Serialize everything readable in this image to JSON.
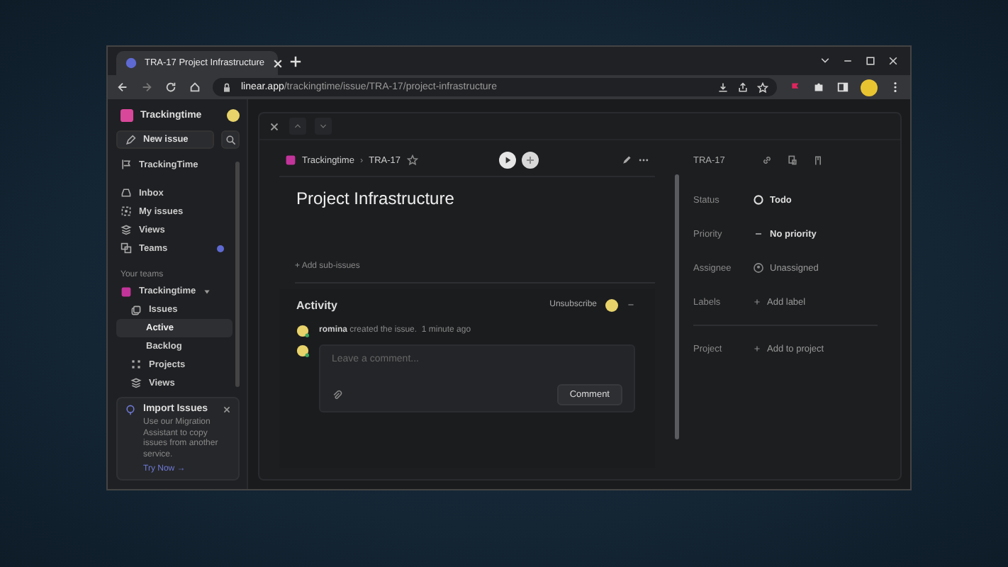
{
  "browser": {
    "tab_title": "TRA-17 Project Infrastructure",
    "url_host": "linear.app",
    "url_path": "/trackingtime/issue/TRA-17/project-infrastructure"
  },
  "sidebar": {
    "workspace": "Trackingtime",
    "new_issue": "New issue",
    "team_link": "TrackingTime",
    "nav": [
      {
        "label": "Inbox",
        "kind": "inbox",
        "badge": false
      },
      {
        "label": "My issues",
        "kind": "target",
        "badge": false
      },
      {
        "label": "Views",
        "kind": "layers",
        "badge": false
      },
      {
        "label": "Teams",
        "kind": "teams",
        "badge": true
      }
    ],
    "section": "Your teams",
    "team": {
      "label": "Trackingtime",
      "expanded": true,
      "children": [
        {
          "label": "Issues",
          "kind": "issues",
          "selected": false,
          "children": [
            {
              "label": "Active",
              "selected": true
            },
            {
              "label": "Backlog",
              "selected": false
            }
          ]
        },
        {
          "label": "Projects",
          "kind": "grid",
          "selected": false
        },
        {
          "label": "Views",
          "kind": "layers",
          "selected": false
        }
      ]
    },
    "import_card": {
      "title": "Import Issues",
      "body": "Use our Migration Assistant to copy issues from another service.",
      "link": "Try Now →"
    }
  },
  "issue": {
    "breadcrumb": [
      "Trackingtime",
      "›",
      "TRA-17"
    ],
    "title": "Project Infrastructure",
    "add_sub_issues": "+ Add sub-issues",
    "activity": {
      "heading": "Activity",
      "unsubscribe": "Unsubscribe",
      "events": [
        {
          "user": "romina",
          "text": "created the issue.",
          "time": "1 minute ago"
        }
      ],
      "comment": {
        "placeholder": "Leave a comment...",
        "button": "Comment"
      }
    }
  },
  "properties": {
    "id": "TRA-17",
    "rows": [
      {
        "label": "Status",
        "kind": "status",
        "value": "Todo"
      },
      {
        "label": "Priority",
        "kind": "priority",
        "value": "No priority"
      },
      {
        "label": "Assignee",
        "kind": "assignee",
        "value": "Unassigned"
      },
      {
        "label": "Labels",
        "kind": "add",
        "value": "Add label"
      },
      {
        "label": "Project",
        "kind": "add",
        "value": "Add to project"
      }
    ]
  }
}
